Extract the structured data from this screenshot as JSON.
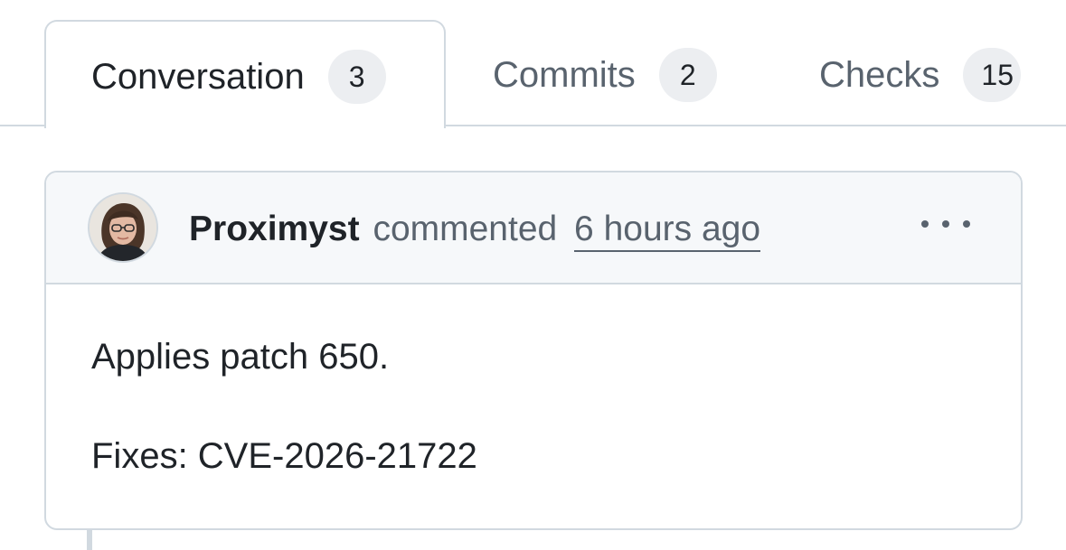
{
  "tabs": [
    {
      "label": "Conversation",
      "count": "3",
      "active": true
    },
    {
      "label": "Commits",
      "count": "2",
      "active": false
    },
    {
      "label": "Checks",
      "count": "15",
      "active": false
    }
  ],
  "comment": {
    "author": "Proximyst",
    "action": "commented",
    "timestamp": "6 hours ago",
    "avatar_icon": "user-avatar",
    "menu_icon": "kebab-horizontal-icon",
    "body": [
      "Applies patch 650.",
      "Fixes: CVE-2026-21722"
    ]
  },
  "colors": {
    "border": "#d1d9e0",
    "header_bg": "#f6f8fa",
    "muted_text": "#59636e",
    "primary_text": "#1f2328",
    "counter_bg": "#eceef1"
  }
}
